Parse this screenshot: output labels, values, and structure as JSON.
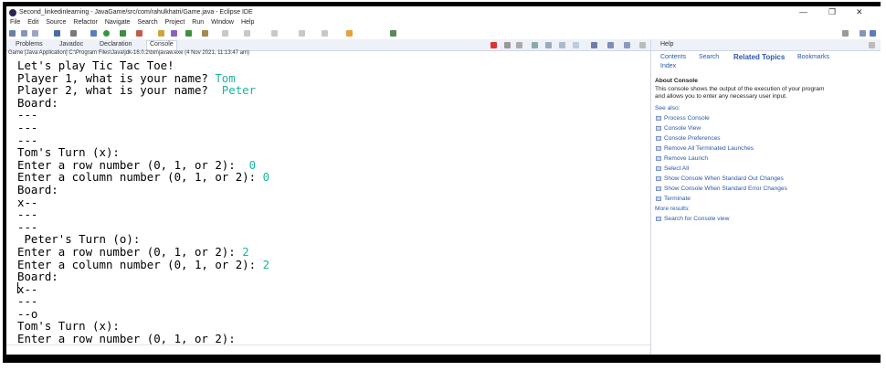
{
  "window": {
    "title": "Second_linkedinlearning - JavaGame/src/com/rahulkhatri/Game.java - Eclipse IDE",
    "controls": [
      "—",
      "❐",
      "✕"
    ]
  },
  "menu": [
    "File",
    "Edit",
    "Source",
    "Refactor",
    "Navigate",
    "Search",
    "Project",
    "Run",
    "Window",
    "Help"
  ],
  "left_tabs": [
    "Problems",
    "Javadoc",
    "Declaration",
    "Console"
  ],
  "console_desc": "Game [Java Application] C:\\Program Files\\Java\\jdk-16.0.2\\bin\\javaw.exe (4 Nov 2021, 11:13:47 am)",
  "console": {
    "lines": [
      {
        "text": "Let's play Tic Tac Toe!",
        "input": ""
      },
      {
        "text": "Player 1, what is your name? ",
        "input": "Tom"
      },
      {
        "text": "Player 2, what is your name?  ",
        "input": "Peter"
      },
      {
        "text": "Board:",
        "input": ""
      },
      {
        "text": "---",
        "input": ""
      },
      {
        "text": "---",
        "input": ""
      },
      {
        "text": "---",
        "input": ""
      },
      {
        "text": "Tom's Turn (x):",
        "input": ""
      },
      {
        "text": "Enter a row number (0, 1, or 2):  ",
        "input": "0"
      },
      {
        "text": "Enter a column number (0, 1, or 2): ",
        "input": "0"
      },
      {
        "text": "Board:",
        "input": ""
      },
      {
        "text": "x--",
        "input": ""
      },
      {
        "text": "---",
        "input": ""
      },
      {
        "text": "---",
        "input": ""
      },
      {
        "text": " Peter's Turn (o):",
        "input": ""
      },
      {
        "text": "Enter a row number (0, 1, or 2): ",
        "input": "2"
      },
      {
        "text": "Enter a column number (0, 1, or 2): ",
        "input": "2"
      },
      {
        "text": "Board:",
        "input": ""
      },
      {
        "text": "x--",
        "input": ""
      },
      {
        "text": "---",
        "input": ""
      },
      {
        "text": "--o",
        "input": ""
      },
      {
        "text": "Tom's Turn (x):",
        "input": ""
      },
      {
        "text": "Enter a row number (0, 1, or 2):",
        "input": ""
      }
    ],
    "input_color": "#18b5a0"
  },
  "help": {
    "tab": "Help",
    "links": {
      "contents": "Contents",
      "search": "Search",
      "related": "Related Topics",
      "bookmarks": "Bookmarks",
      "index": "Index"
    },
    "about_title": "About Console",
    "about_text_1": "This console shows the output of the execution of your program",
    "about_text_2": "and allows you to enter any necessary user input.",
    "see_also": "See also:",
    "see_also_links": [
      "Process Console",
      "Console View",
      "Console Preferences",
      "Remove All Terminated Launches",
      "Remove Launch",
      "Select All",
      "Show Console When Standard Out Changes",
      "Show Console When Standard Error Changes",
      "Terminate"
    ],
    "more_results": "More results:",
    "search_for": "Search for Console view"
  }
}
